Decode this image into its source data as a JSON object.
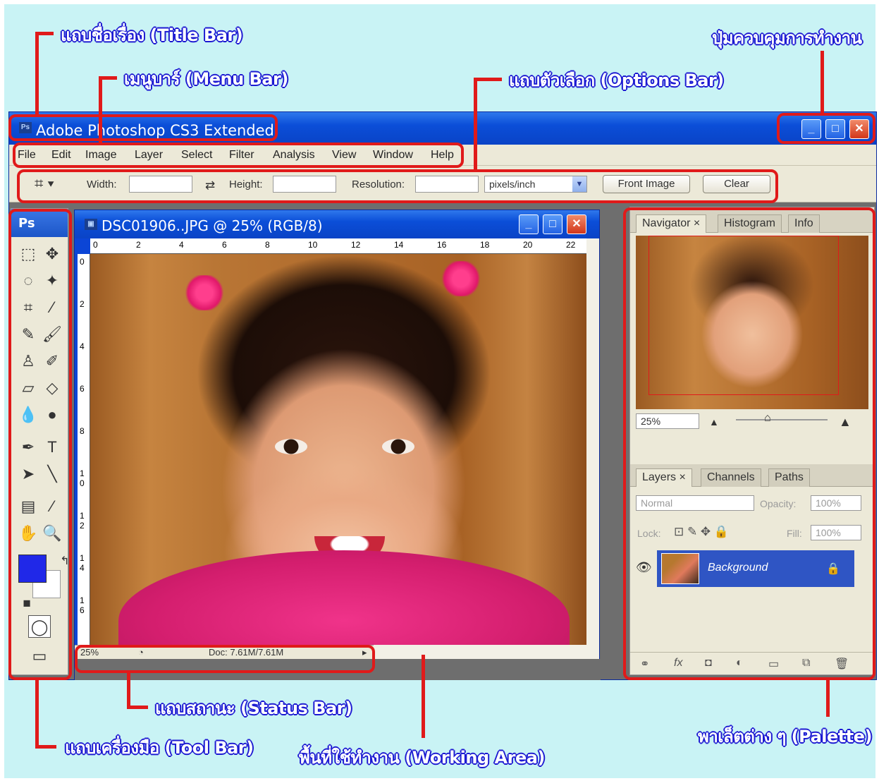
{
  "annotations": {
    "title_bar": "แถบชื่อเรื่อง (Title Bar)",
    "menu_bar": "เมนูบาร์ (Menu Bar)",
    "options_bar": "แถบตัวเลือก (Options Bar)",
    "window_controls": "ปุ่มควบคุมการทำงาน",
    "status_bar": "แถบสถานะ (Status Bar)",
    "tool_bar": "แถบเครื่องมือ (Tool Bar)",
    "working_area": "พื้นที่ใช้ทำงาน (Working Area)",
    "palette": "พาเล็ตต่าง ๆ (Palette)"
  },
  "app": {
    "logo": "Ps",
    "title": "Adobe Photoshop CS3 Extended",
    "minimize": "_",
    "maximize": "□",
    "close": "✕"
  },
  "menu": [
    "File",
    "Edit",
    "Image",
    "Layer",
    "Select",
    "Filter",
    "Analysis",
    "View",
    "Window",
    "Help"
  ],
  "options": {
    "width_label": "Width:",
    "height_label": "Height:",
    "resolution_label": "Resolution:",
    "units": "pixels/inch",
    "front_image": "Front Image",
    "clear": "Clear",
    "swap_icon": "⇄"
  },
  "toolbox": {
    "title": "Ps",
    "tools": [
      "marquee-icon",
      "move-icon",
      "lasso-icon",
      "magic-wand-icon",
      "crop-icon",
      "slice-icon",
      "healing-brush-icon",
      "brush-icon",
      "clone-stamp-icon",
      "history-brush-icon",
      "eraser-icon",
      "paint-bucket-icon",
      "blur-icon",
      "dodge-icon",
      "pen-icon",
      "type-icon",
      "path-select-icon",
      "line-icon",
      "notes-icon",
      "eyedropper-icon",
      "hand-icon",
      "zoom-icon"
    ],
    "glyphs": [
      "⬚",
      "✥",
      "◌",
      "✦",
      "⌗",
      "⁄",
      "✎",
      "🖌",
      "♙",
      "✐",
      "▱",
      "◇",
      "💧",
      "●",
      "✒",
      "T",
      "➤",
      "╲",
      "▤",
      "⁄",
      "✋",
      "🔍"
    ],
    "fg_color": "#2028e8",
    "bg_color": "#ffffff",
    "quick_mask": "◯",
    "screen_mode": "▭"
  },
  "document": {
    "title": "DSC01906..JPG @ 25% (RGB/8)",
    "ruler_top": [
      "0",
      "2",
      "4",
      "6",
      "8",
      "10",
      "12",
      "14",
      "16",
      "18",
      "20",
      "22"
    ],
    "ruler_left": [
      "0",
      "2",
      "4",
      "6",
      "8",
      "1 0",
      "1 2",
      "1 4",
      "1 6"
    ],
    "zoom": "25%",
    "doc_info": "Doc: 7.61M/7.61M"
  },
  "navigator": {
    "tabs": [
      "Navigator ×",
      "Histogram",
      "Info"
    ],
    "zoom": "25%"
  },
  "layers": {
    "tabs": [
      "Layers ×",
      "Channels",
      "Paths"
    ],
    "blend_mode": "Normal",
    "opacity_label": "Opacity:",
    "opacity": "100%",
    "lock_label": "Lock:",
    "fill_label": "Fill:",
    "fill": "100%",
    "layer_name": "Background"
  },
  "colors": {
    "xp_blue": "#0b4ed8",
    "highlight_red": "#e01a1a",
    "callout_blue": "#1d1ad2",
    "background_cyan": "#c9f3f5"
  }
}
